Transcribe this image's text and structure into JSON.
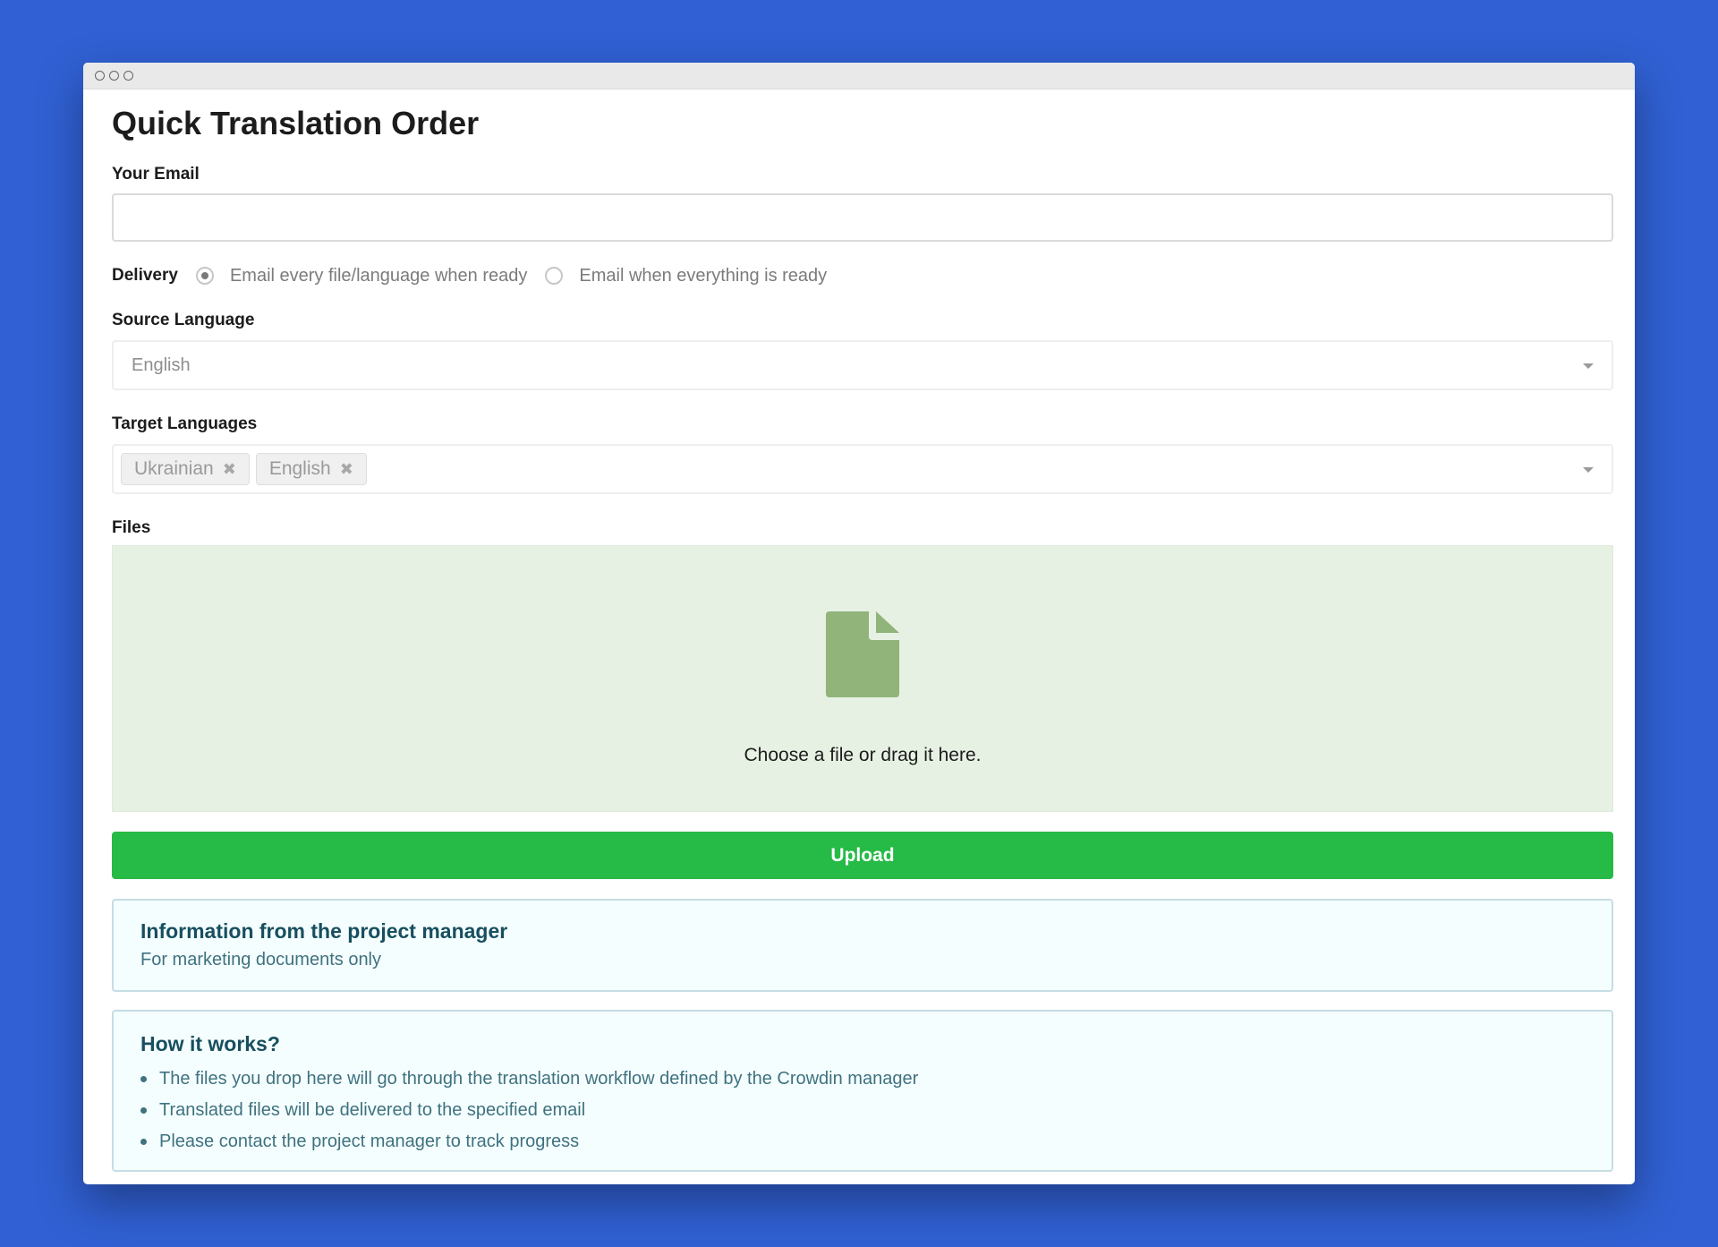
{
  "page": {
    "title": "Quick Translation Order"
  },
  "email": {
    "label": "Your Email",
    "value": "",
    "placeholder": ""
  },
  "delivery": {
    "label": "Delivery",
    "options": [
      {
        "label": "Email every file/language when ready",
        "selected": true
      },
      {
        "label": "Email when everything is ready",
        "selected": false
      }
    ]
  },
  "source_language": {
    "label": "Source Language",
    "value": "English"
  },
  "target_languages": {
    "label": "Target Languages",
    "selected": [
      "Ukrainian",
      "English"
    ],
    "remove_symbol": "✖"
  },
  "files": {
    "label": "Files",
    "dropzone_text": "Choose a file or drag it here."
  },
  "upload": {
    "label": "Upload"
  },
  "pm_info": {
    "title": "Information from the project manager",
    "text": "For marketing documents only"
  },
  "how_it_works": {
    "title": "How it works?",
    "items": [
      "The files you drop here will go through the translation workflow defined by the Crowdin manager",
      "Translated files will be delivered to the specified email",
      "Please contact the project manager to track progress"
    ]
  },
  "colors": {
    "background": "#3060d3",
    "upload_button": "#26ba47",
    "dropzone": "#e7f1e3",
    "file_icon": "#90b47a",
    "info_title": "#174f5f",
    "info_text": "#3e7280"
  },
  "icons": {
    "file": "file-icon",
    "dropdown": "chevron-down-icon",
    "remove": "close-icon"
  }
}
